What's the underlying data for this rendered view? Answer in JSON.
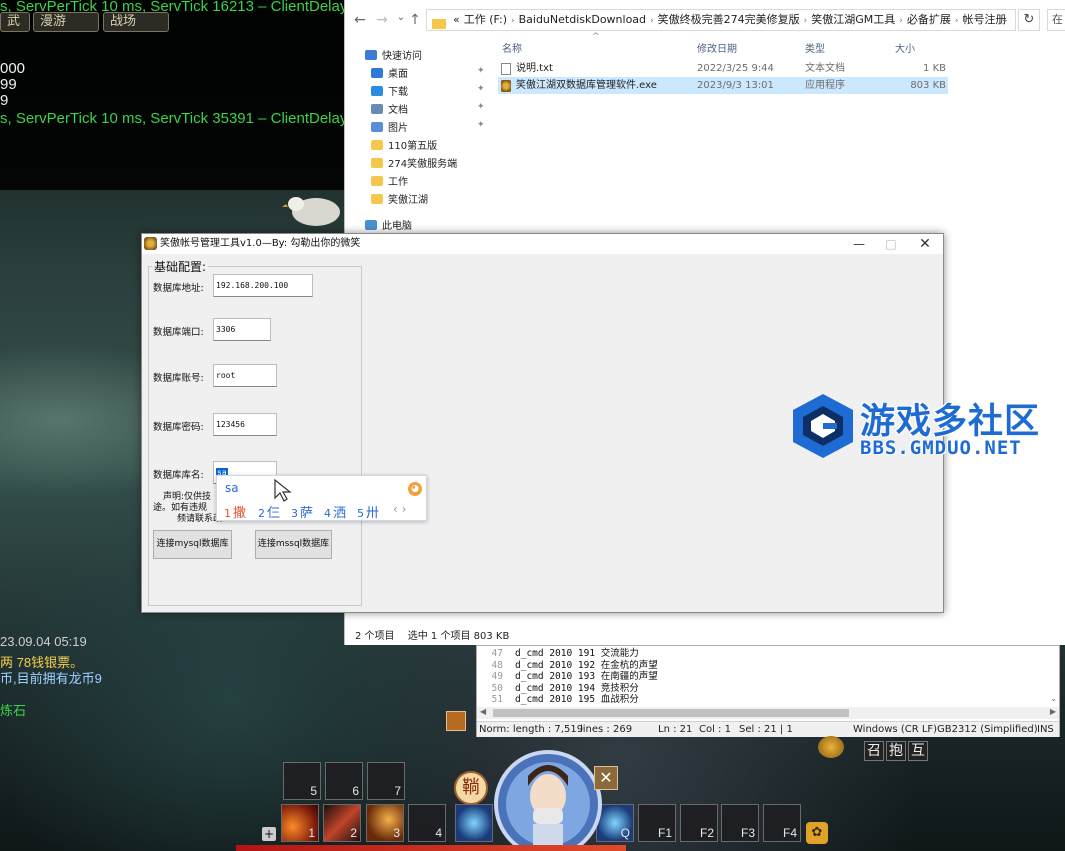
{
  "game": {
    "log_lines": [
      {
        "text": "s, ServPerTick 10 ms, ServTick 16213 – ClientDelay",
        "color": "#3cd24a"
      },
      {
        "text": "000",
        "color": "#f0f0f0"
      },
      {
        "text": "99",
        "color": "#f0f0f0"
      },
      {
        "text": "9",
        "color": "#f0f0f0"
      },
      {
        "text": "s, ServPerTick 10 ms, ServTick 35391 – ClientDelay",
        "color": "#3cd24a"
      }
    ],
    "top_buttons": [
      "武",
      "漫游",
      "战场"
    ],
    "chat_lines": [
      {
        "text": "23.09.04 05:19",
        "color": "#cfcfcf"
      },
      {
        "text": "两 78钱银票。",
        "color": "#f5d04a"
      },
      {
        "text": "币,目前拥有龙币9",
        "color": "#9fd0ff"
      },
      {
        "text": "炼石",
        "color": "#3cd24a"
      }
    ],
    "hotbar_top": [
      {
        "key": "5"
      },
      {
        "key": "6"
      },
      {
        "key": "7"
      }
    ],
    "hotbar_bottom": [
      {
        "key": "1",
        "skill": "fire"
      },
      {
        "key": "2",
        "skill": "blade"
      },
      {
        "key": "3",
        "skill": "claw"
      },
      {
        "key": "4",
        "skill": "empty"
      },
      {
        "key": "",
        "skill": "ice"
      },
      {
        "key": "Q",
        "skill": "ice"
      },
      {
        "key": "F1",
        "skill": "empty"
      },
      {
        "key": "F2",
        "skill": "empty"
      },
      {
        "key": "F3",
        "skill": "empty"
      },
      {
        "key": "F4",
        "skill": "empty"
      }
    ],
    "social_buttons": [
      "召",
      "抱",
      "互"
    ],
    "emblem_char": "鞝"
  },
  "explorer": {
    "address_crumbs": [
      "«",
      "工作 (F:)",
      "BaiduNetdiskDownload",
      "笑傲终极完善274完美修复版",
      "笑傲江湖GM工具",
      "必备扩展",
      "帐号注册"
    ],
    "search_placeholder": "在",
    "sidebar": [
      {
        "label": "快速访问",
        "icon": "star-icon",
        "pinned": false
      },
      {
        "label": "桌面",
        "icon": "desktop-icon",
        "pinned": true
      },
      {
        "label": "下载",
        "icon": "download-icon",
        "pinned": true
      },
      {
        "label": "文档",
        "icon": "document-icon",
        "pinned": true
      },
      {
        "label": "图片",
        "icon": "picture-icon",
        "pinned": true
      },
      {
        "label": "110第五版",
        "icon": "folder-icon",
        "pinned": false
      },
      {
        "label": "274笑傲服务端",
        "icon": "folder-icon",
        "pinned": false
      },
      {
        "label": "工作",
        "icon": "folder-icon",
        "pinned": false
      },
      {
        "label": "笑傲江湖",
        "icon": "folder-icon",
        "pinned": false
      },
      {
        "label": "此电脑",
        "icon": "computer-icon",
        "pinned": false
      }
    ],
    "columns": {
      "name": "名称",
      "modified": "修改日期",
      "type": "类型",
      "size": "大小"
    },
    "files": [
      {
        "name": "说明.txt",
        "modified": "2022/3/25 9:44",
        "type": "文本文档",
        "size": "1 KB",
        "icon": "text-file-icon",
        "selected": false
      },
      {
        "name": "笑傲江湖双数据库管理软件.exe",
        "modified": "2023/9/3 13:01",
        "type": "应用程序",
        "size": "803 KB",
        "icon": "exe-file-icon",
        "selected": true
      }
    ],
    "status": {
      "count": "2 个项目",
      "selected": "选中 1 个项目  803 KB"
    }
  },
  "editor": {
    "lines": [
      {
        "num": "47",
        "code": "d_cmd 2010 191 交流能力"
      },
      {
        "num": "48",
        "code": "d_cmd 2010 192 在金杭的声望"
      },
      {
        "num": "49",
        "code": "d_cmd 2010 193 在南疆的声望"
      },
      {
        "num": "50",
        "code": "d_cmd 2010 194 竞技积分"
      },
      {
        "num": "51",
        "code": "d_cmd 2010 195 血战积分"
      }
    ],
    "status": {
      "length": "Norm: length : 7,519",
      "lines": "lines : 269",
      "ln": "Ln : 21",
      "col": "Col : 1",
      "sel": "Sel : 21 | 1",
      "eol": "Windows (CR LF)",
      "encoding": "GB2312 (Simplified)",
      "mode": "INS"
    }
  },
  "tool": {
    "title": "笑傲帐号管理工具v1.0—By: 勾勒出你的微笑",
    "group_label": "基础配置:",
    "fields": [
      {
        "label": "数据库地址:",
        "value": "192.168.200.100"
      },
      {
        "label": "数据库端口:",
        "value": "3306"
      },
      {
        "label": "数据库账号:",
        "value": "root"
      },
      {
        "label": "数据库密码:",
        "value": "123456"
      },
      {
        "label": "数据库库名:",
        "value": "sa"
      }
    ],
    "note_lines": [
      "声明:仅供技",
      "途。如有违规",
      "频请联系改"
    ],
    "buttons": {
      "mysql": "连接mysql数据库",
      "mssql": "连接mssql数据库"
    }
  },
  "ime": {
    "composition": "sa",
    "candidates": [
      {
        "num": "1",
        "char": "撒"
      },
      {
        "num": "2",
        "char": "仨"
      },
      {
        "num": "3",
        "char": "萨"
      },
      {
        "num": "4",
        "char": "洒"
      },
      {
        "num": "5",
        "char": "卅"
      }
    ],
    "nav": "‹ ›"
  },
  "watermark": {
    "cn": "游戏多社区",
    "en": "BBS.GMDUO.NET",
    "color": "#1e6cd3"
  }
}
